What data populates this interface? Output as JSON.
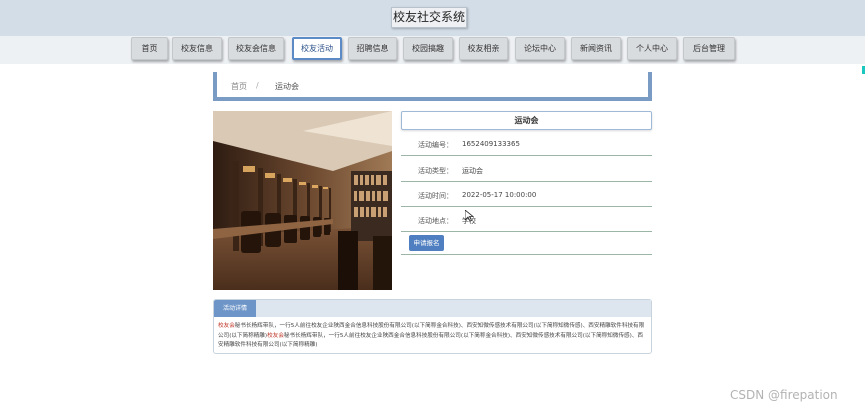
{
  "app": {
    "title": "校友社交系统"
  },
  "nav": [
    {
      "label": "首页"
    },
    {
      "label": "校友信息"
    },
    {
      "label": "校友会信息"
    },
    {
      "label": "校友活动",
      "active": true
    },
    {
      "label": "招聘信息"
    },
    {
      "label": "校园搞趣"
    },
    {
      "label": "校友相亲"
    },
    {
      "label": "论坛中心"
    },
    {
      "label": "新闻资讯"
    },
    {
      "label": "个人中心"
    },
    {
      "label": "后台管理"
    }
  ],
  "breadcrumb": {
    "home": "首页",
    "separator": "/",
    "current": "运动会"
  },
  "activity": {
    "name": "运动会",
    "fields": [
      {
        "label": "活动编号：",
        "value": "1652409133365"
      },
      {
        "label": "活动类型：",
        "value": "运动会"
      },
      {
        "label": "活动时间：",
        "value": "2022-05-17 10:00:00"
      },
      {
        "label": "活动地点：",
        "value": "学校"
      }
    ],
    "apply_label": "申请报名"
  },
  "details": {
    "tab_label": "活动详情",
    "hl1": "校友会",
    "seg1": "秘书长杨辉带队，一行5人前往校友企业陕西金合信息科技股份有限公司(以下简称金合科技)、西安知微传感技术有限公司(以下简称知微传感)、西安精雕软件科技有限公司(以下简称精雕)",
    "hl2": "校友会",
    "seg2": "秘书长杨辉带队，一行5人前往校友企业陕西金合信息科技股份有限公司(以下简称金合科技)、西安知微传感技术有限公司(以下简称知微传感)、西安精雕软件科技有限公司(以下简称精雕)"
  },
  "watermark": "CSDN @firepation",
  "colors": {
    "topbar": "#d3dde7",
    "accent": "#5b8ac7",
    "button": "#4f7fc0",
    "highlight": "#c0392b"
  }
}
